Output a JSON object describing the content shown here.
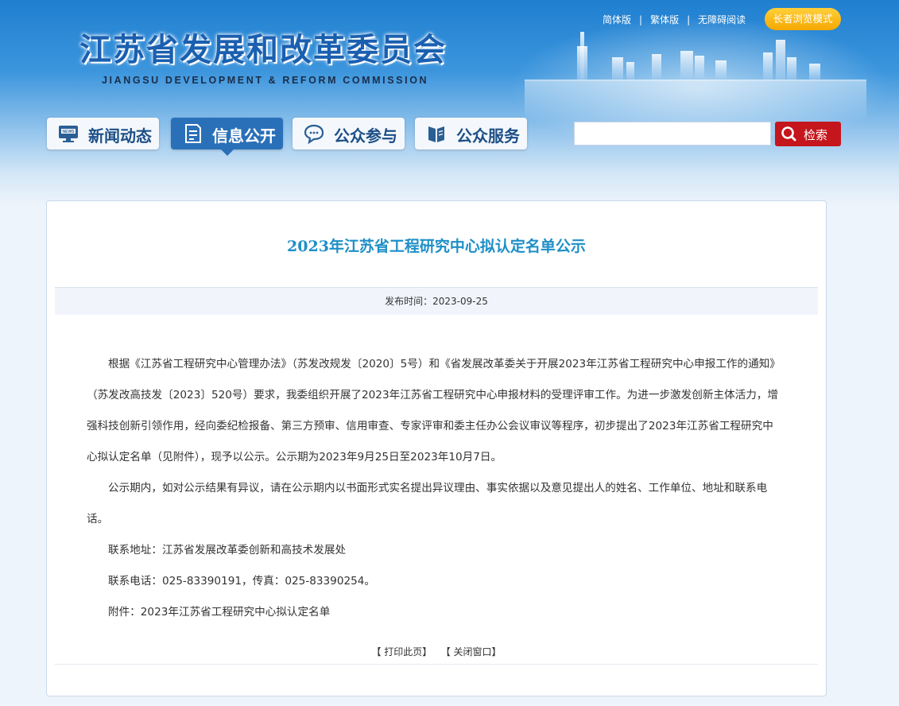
{
  "site": {
    "title": "江苏省发展和改革委员会",
    "subtitle": "JIANGSU DEVELOPMENT & REFORM COMMISSION"
  },
  "top_links": {
    "simplified": "简体版",
    "traditional": "繁体版",
    "accessible": "无障碍阅读",
    "separator": "|",
    "elder_mode": "长者浏览模式"
  },
  "nav": {
    "items": [
      {
        "label": "新闻动态",
        "icon": "news-icon"
      },
      {
        "label": "信息公开",
        "icon": "document-icon",
        "active": true
      },
      {
        "label": "公众参与",
        "icon": "chat-icon"
      },
      {
        "label": "公众服务",
        "icon": "book-icon"
      }
    ]
  },
  "search": {
    "value": "",
    "placeholder": "",
    "button_label": "检索"
  },
  "article": {
    "title": "2023年江苏省工程研究中心拟认定名单公示",
    "publish_time": "发布时间：2023-09-25",
    "paragraphs": [
      "根据《江苏省工程研究中心管理办法》（苏发改规发〔2020〕5号）和《省发展改革委关于开展2023年江苏省工程研究中心申报工作的通知》（苏发改高技发〔2023〕520号）要求，我委组织开展了2023年江苏省工程研究中心申报材料的受理评审工作。为进一步激发创新主体活力，增强科技创新引领作用，经向委纪检报备、第三方预审、信用审查、专家评审和委主任办公会议审议等程序，初步提出了2023年江苏省工程研究中心拟认定名单（见附件），现予以公示。公示期为2023年9月25日至2023年10月7日。",
      "公示期内，如对公示结果有异议，请在公示期内以书面形式实名提出异议理由、事实依据以及意见提出人的姓名、工作单位、地址和联系电话。",
      "联系地址：江苏省发展改革委创新和高技术发展处",
      "联系电话：025-83390191，传真：025-83390254。",
      "附件：2023年江苏省工程研究中心拟认定名单"
    ]
  },
  "actions": {
    "print": "【 打印此页】",
    "close": "【 关闭窗口】"
  },
  "colors": {
    "header_blue": "#1f7fd0",
    "nav_active": "#2a70b8",
    "title_blue": "#1f8fc7",
    "search_red": "#c4161c",
    "elder_yellow": "#f5a800"
  }
}
